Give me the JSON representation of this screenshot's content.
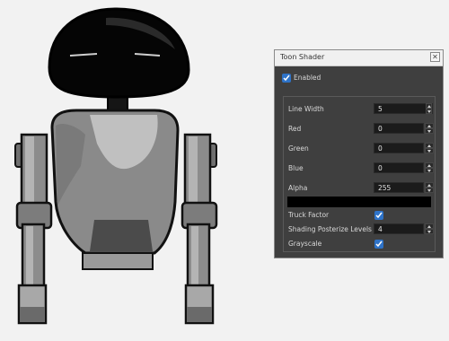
{
  "panel": {
    "title": "Toon Shader",
    "close_glyph": "✕",
    "enabled_label": "Enabled",
    "enabled_checked": true,
    "fields": {
      "line_width": {
        "label": "Line Width",
        "value": "5"
      },
      "red": {
        "label": "Red",
        "value": "0"
      },
      "green": {
        "label": "Green",
        "value": "0"
      },
      "blue": {
        "label": "Blue",
        "value": "0"
      },
      "alpha": {
        "label": "Alpha",
        "value": "255"
      },
      "shading_posterize_levels": {
        "label": "Shading Posterize Levels",
        "value": "4"
      }
    },
    "truck_factor": {
      "label": "Truck Factor",
      "checked": true
    },
    "grayscale": {
      "label": "Grayscale",
      "checked": true
    },
    "color_preview": "#000000",
    "checkbox_color": "#2e73c8"
  },
  "icons": [
    "close-icon",
    "check-icon",
    "spinner-up-icon",
    "spinner-down-icon"
  ]
}
